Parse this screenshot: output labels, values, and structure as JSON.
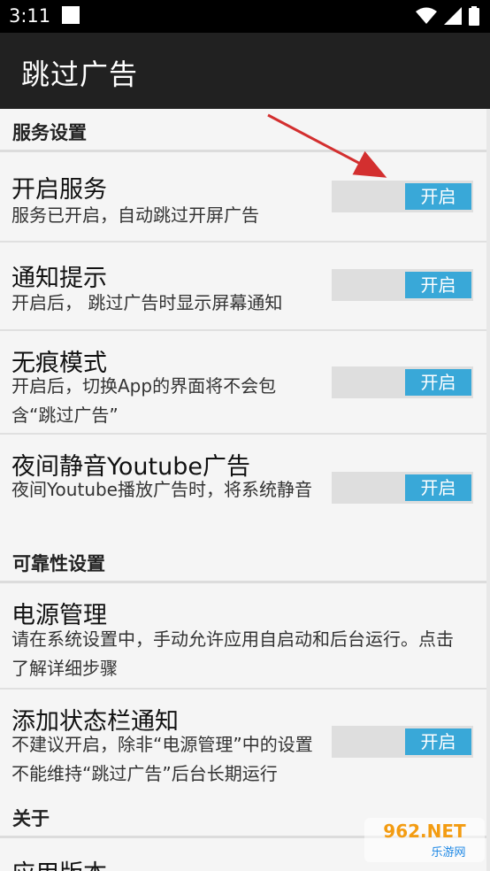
{
  "status_bar": {
    "time": "3:11",
    "icons": [
      "notification-square-icon",
      "wifi-icon",
      "signal-icon",
      "battery-icon"
    ]
  },
  "app_bar": {
    "title": "跳过广告"
  },
  "sections": [
    {
      "header": "服务设置",
      "items": [
        {
          "title": "开启服务",
          "summary": "服务已开启，自动跳过开屏广告",
          "toggle": "开启"
        },
        {
          "title": "通知提示",
          "summary": "开启后， 跳过广告时显示屏幕通知",
          "toggle": "开启"
        },
        {
          "title": "无痕模式",
          "summary": "开启后，切换App的界面将不会包含“跳过广告”",
          "toggle": "开启"
        },
        {
          "title": "夜间静音Youtube广告",
          "summary": "夜间Youtube播放广告时，将系统静音",
          "toggle": "开启"
        }
      ]
    },
    {
      "header": "可靠性设置",
      "items": [
        {
          "title": "电源管理",
          "summary": "请在系统设置中，手动允许应用自启动和后台运行。点击了解详细步骤"
        },
        {
          "title": "添加状态栏通知",
          "summary": "不建议开启，除非“电源管理”中的设置不能维持“跳过广告”后台长期运行",
          "toggle": "开启"
        }
      ]
    },
    {
      "header": "关于",
      "items": [
        {
          "title": "应用版本"
        }
      ]
    }
  ],
  "watermark": {
    "brand": "962.NET",
    "sub": "乐游网"
  },
  "colors": {
    "accent": "#39a8d8",
    "app_bar": "#212121",
    "arrow": "#d32f2f"
  }
}
